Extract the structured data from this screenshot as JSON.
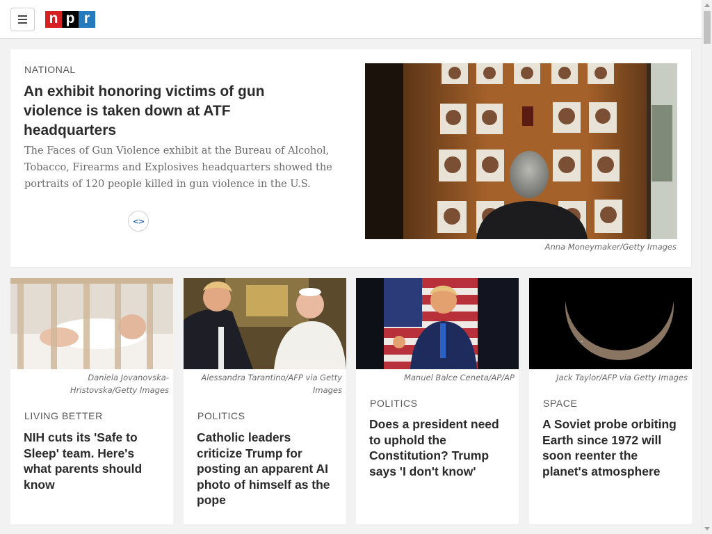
{
  "header": {
    "logo_letters": [
      "n",
      "p",
      "r"
    ],
    "logo_colors": [
      "#d62021",
      "#000000",
      "#237bbd"
    ],
    "menu_icon": "hamburger-menu-icon"
  },
  "featured": {
    "kicker": "NATIONAL",
    "title": "An exhibit honoring victims of gun violence is taken down at ATF headquarters",
    "teaser": "The Faces of Gun Violence exhibit at the Bureau of Alcohol, Tobacco, Firearms and Explosives headquarters showed the portraits of 120 people killed in gun violence in the U.S.",
    "embed_glyph": "<>",
    "photo_credit": "Anna Moneymaker/Getty Images"
  },
  "cards": [
    {
      "photo_credit": "Daniela Jovanovska-Hristovska/Getty Images",
      "kicker": "LIVING BETTER",
      "title": "NIH cuts its 'Safe to Sleep' team. Here's what parents should know"
    },
    {
      "photo_credit": "Alessandra Tarantino/AFP via Getty Images",
      "kicker": "POLITICS",
      "title": "Catholic leaders criticize Trump for posting an apparent AI photo of himself as the pope"
    },
    {
      "photo_credit": "Manuel Balce Ceneta/AP/AP",
      "kicker": "POLITICS",
      "title": "Does a president need to uphold the Constitution? Trump says 'I don't know'"
    },
    {
      "photo_credit": "Jack Taylor/AFP via Getty Images",
      "kicker": "SPACE",
      "title": "A Soviet probe orbiting Earth since 1972 will soon reenter the planet's atmosphere"
    }
  ]
}
